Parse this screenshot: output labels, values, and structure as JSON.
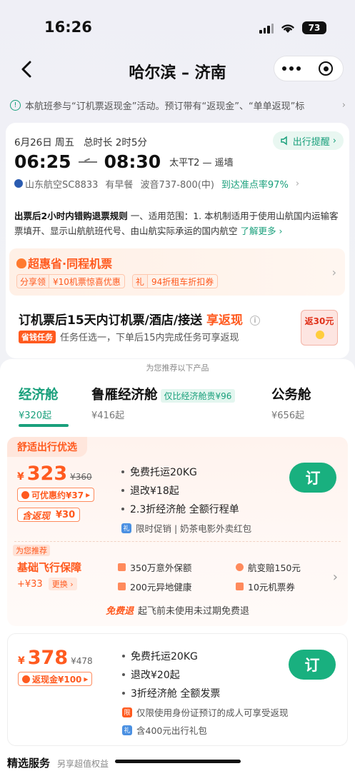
{
  "status": {
    "time": "16:26",
    "battery": "73"
  },
  "nav": {
    "title": "哈尔滨 – 济南"
  },
  "notice": {
    "text": "本航班参与“订机票返现金”活动。预订带有“返现金”、“单单返现”标"
  },
  "flight": {
    "date": "6月26日 周五",
    "duration": "总时长 2时5分",
    "remind": "出行提醒",
    "dep_time": "06:25",
    "arr_time": "08:30",
    "airports": "太平T2 — 遥墙",
    "airline": "山东航空SC8833",
    "meal": "有早餐",
    "aircraft": "波音737-800(中)",
    "ontime": "到达准点率97%"
  },
  "rule": {
    "lead": "出票后2小时内错购退票规则",
    "text": "一、适用范围：1. 本机制适用于使用山航国内运输客票填开、显示山航航班代号、由山航实际承运的国内航空",
    "more": "了解更多"
  },
  "promo1": {
    "title": "超惠省·同程机票",
    "chips": [
      {
        "tag": "分享领",
        "val": "¥10机票惊喜优惠"
      },
      {
        "tag": "礼",
        "val": "94折租车折扣券"
      }
    ]
  },
  "promo2": {
    "head_a": "订机票后15天内订机票/酒店/接送",
    "head_b": "享返现",
    "task_tag": "省钱任务",
    "sub": "任务任选一，下单后15内完成任务可享返现",
    "redpack": "返30元"
  },
  "recommend_label": "为您推荐以下产品",
  "tabs": [
    {
      "name": "经济舱",
      "price": "¥320起"
    },
    {
      "name": "鲁雁经济舱",
      "price": "¥416起",
      "badge": "仅比经济舱贵¥96"
    },
    {
      "name": "公务舱",
      "price": "¥656起"
    }
  ],
  "offer1": {
    "tag": "舒适出行优选",
    "currency": "¥",
    "price": "323",
    "old_price": "¥360",
    "discount": "可优惠约¥37",
    "cashback_label": "含返现",
    "cashback_val": "¥30",
    "features": [
      "免费托运20KG",
      "退改¥18起",
      "2.3折经济舱   全额行程单"
    ],
    "gift_icon": "礼",
    "gift": "限时促销 | 奶茶电影外卖红包",
    "book": "订",
    "ins_tag": "为您推荐",
    "ins_title": "基础飞行保障",
    "ins_price": "+¥33",
    "ins_swap": "更换",
    "ins_items": [
      "350万意外保额",
      "航变赔150元",
      "200元异地健康",
      "10元机票券"
    ],
    "free_ret_label": "免费退",
    "free_ret_text": "起飞前未使用未过期免费退"
  },
  "offer2": {
    "currency": "¥",
    "price": "378",
    "old_price": "¥478",
    "refund": "返现金¥100",
    "features": [
      "免费托运20KG",
      "退改¥20起",
      "3折经济舱   全额发票"
    ],
    "limit_icon": "限",
    "limit": "仅限使用身份证预订的成人可享受返现",
    "gift_icon": "礼",
    "gift": "含400元出行礼包",
    "book": "订"
  },
  "bottom": {
    "title": "精选服务",
    "sub": "另享超值权益"
  },
  "colors": {
    "accent_green": "#1aa07c",
    "accent_orange": "#ff5a1f",
    "book_button": "#19b07f"
  }
}
